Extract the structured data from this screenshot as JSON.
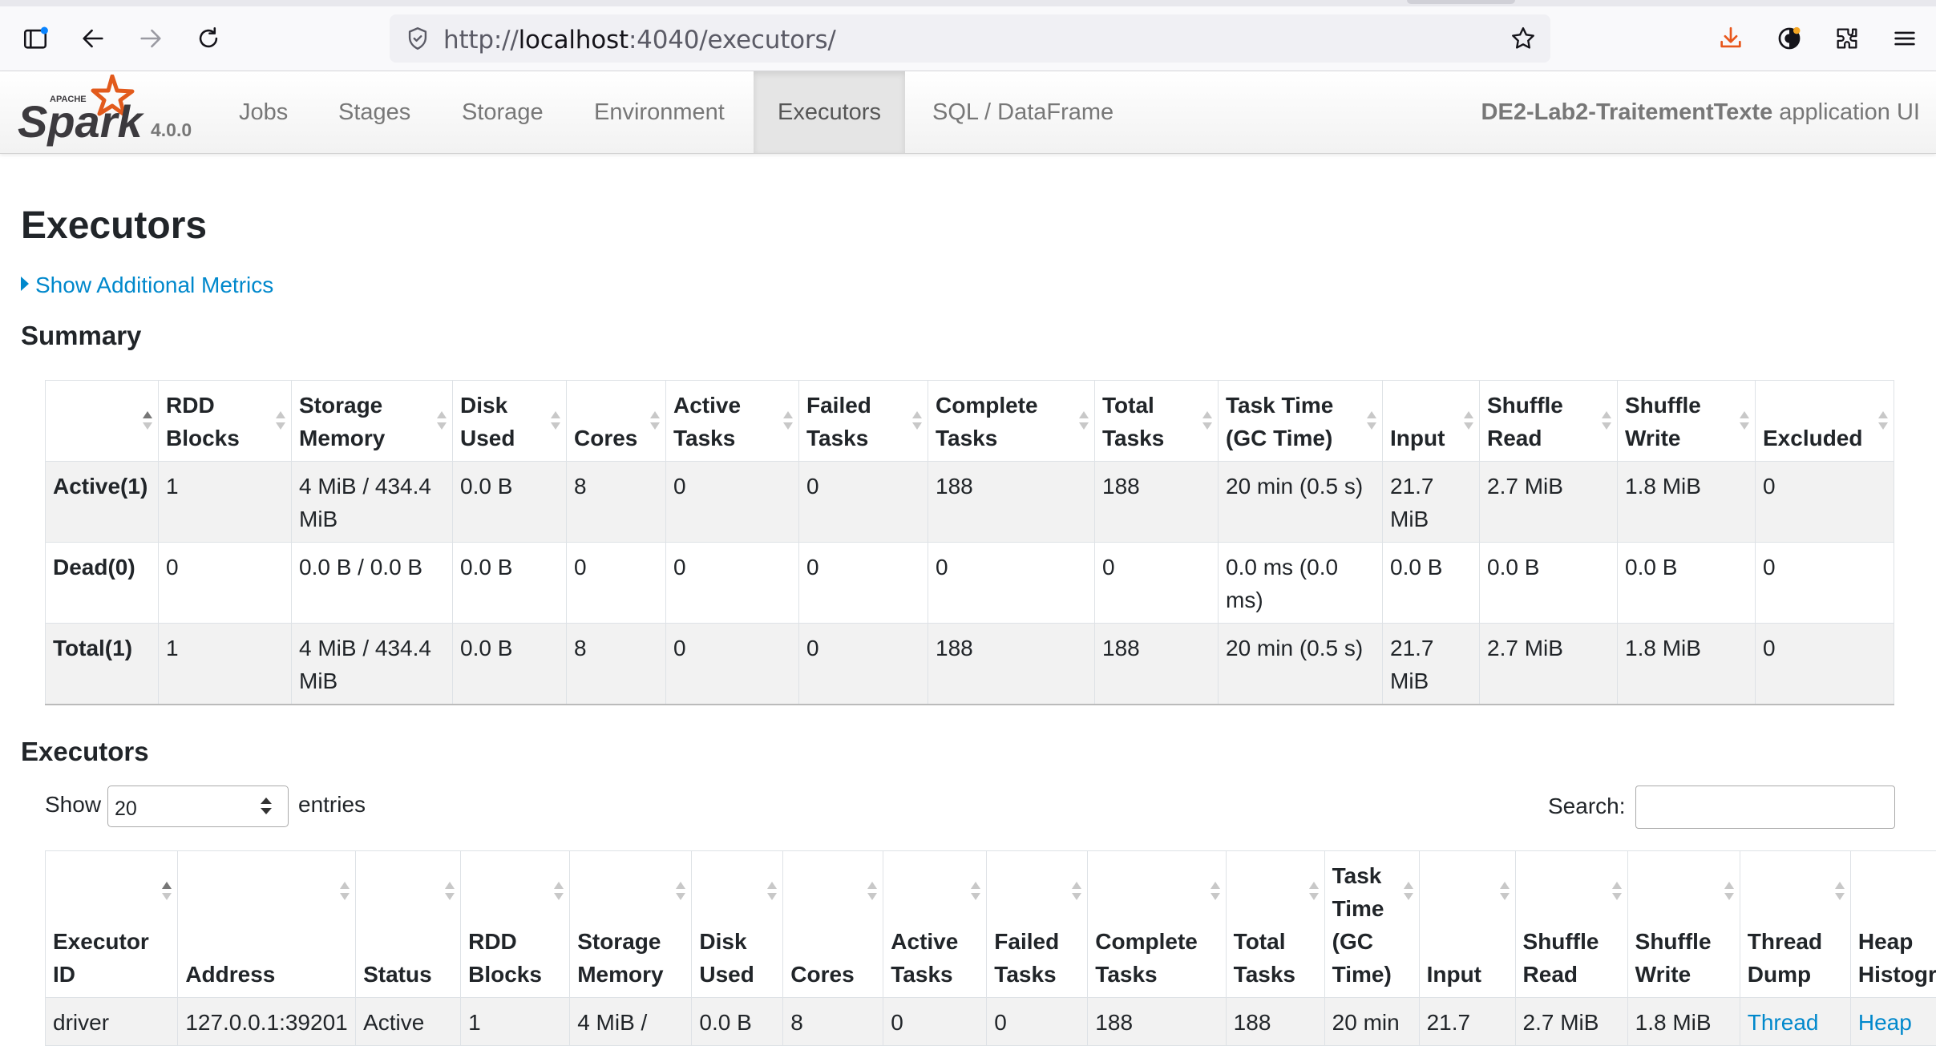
{
  "browser": {
    "url_prefix": "http://",
    "url_host": "localhost",
    "url_rest": ":4040/executors/"
  },
  "navbar": {
    "logo_text": "Spark",
    "logo_apache": "APACHE",
    "version": "4.0.0",
    "tabs": [
      {
        "label": "Jobs"
      },
      {
        "label": "Stages"
      },
      {
        "label": "Storage"
      },
      {
        "label": "Environment"
      },
      {
        "label": "Executors"
      },
      {
        "label": "SQL / DataFrame"
      }
    ],
    "active_tab": "Executors",
    "app_name": "DE2-Lab2-TraitementTexte",
    "app_suffix": " application UI"
  },
  "page": {
    "title": "Executors",
    "additional_metrics": "Show Additional Metrics"
  },
  "summary": {
    "heading": "Summary",
    "columns": [
      "",
      "RDD Blocks",
      "Storage Memory",
      "Disk Used",
      "Cores",
      "Active Tasks",
      "Failed Tasks",
      "Complete Tasks",
      "Total Tasks",
      "Task Time (GC Time)",
      "Input",
      "Shuffle Read",
      "Shuffle Write",
      "Excluded"
    ],
    "rows": [
      [
        "Active(1)",
        "1",
        "4 MiB / 434.4 MiB",
        "0.0 B",
        "8",
        "0",
        "0",
        "188",
        "188",
        "20 min (0.5 s)",
        "21.7 MiB",
        "2.7 MiB",
        "1.8 MiB",
        "0"
      ],
      [
        "Dead(0)",
        "0",
        "0.0 B / 0.0 B",
        "0.0 B",
        "0",
        "0",
        "0",
        "0",
        "0",
        "0.0 ms (0.0 ms)",
        "0.0 B",
        "0.0 B",
        "0.0 B",
        "0"
      ],
      [
        "Total(1)",
        "1",
        "4 MiB / 434.4 MiB",
        "0.0 B",
        "8",
        "0",
        "0",
        "188",
        "188",
        "20 min (0.5 s)",
        "21.7 MiB",
        "2.7 MiB",
        "1.8 MiB",
        "0"
      ]
    ]
  },
  "executors": {
    "heading": "Executors",
    "show_label": "Show",
    "page_size": "20",
    "entries_label": "entries",
    "search_label": "Search:",
    "columns": [
      "Executor ID",
      "Address",
      "Status",
      "RDD Blocks",
      "Storage Memory",
      "Disk Used",
      "Cores",
      "Active Tasks",
      "Failed Tasks",
      "Complete Tasks",
      "Total Tasks",
      "Task Time (GC Time)",
      "Input",
      "Shuffle Read",
      "Shuffle Write",
      "Thread Dump",
      "Heap Histogram"
    ],
    "rows": [
      [
        "driver",
        "127.0.0.1:39201",
        "Active",
        "1",
        "4 MiB /",
        "0.0 B",
        "8",
        "0",
        "0",
        "188",
        "188",
        "20 min",
        "21.7",
        "2.7 MiB",
        "1.8 MiB",
        "Thread",
        "Heap"
      ]
    ]
  },
  "colors": {
    "link": "#0088cc",
    "spark_orange": "#e25a1c",
    "nav_active_bg": "#e5e5e5"
  }
}
